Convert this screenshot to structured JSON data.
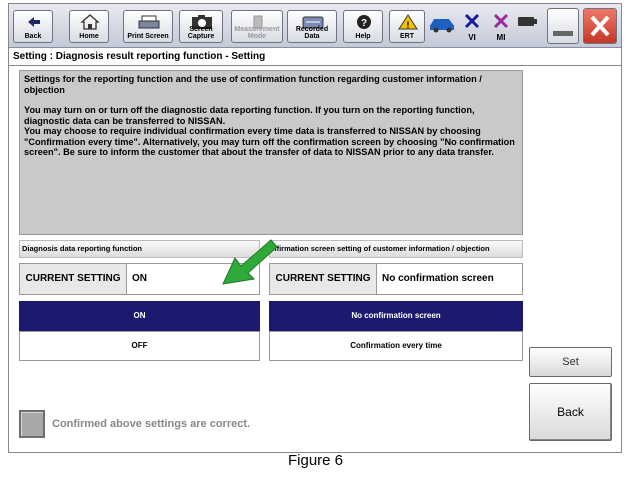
{
  "toolbar": {
    "buttons": [
      {
        "label": "Back"
      },
      {
        "label": "Home"
      },
      {
        "label": "Print Screen"
      },
      {
        "label": "Screen\nCapture"
      },
      {
        "label": "Measurement\nMode"
      },
      {
        "label": "Recorded\nData"
      },
      {
        "label": "Help"
      },
      {
        "label": "ERT"
      }
    ],
    "vi_label": "VI",
    "mi_label": "MI"
  },
  "title": "Setting : Diagnosis result reporting function - Setting",
  "message": {
    "heading": "Settings for the reporting function and the use of confirmation function regarding customer information / objection",
    "body": "You may turn on or turn off the diagnostic data reporting function. If you turn on the reporting function, diagnostic data can be transferred to NISSAN.\nYou may choose to require individual confirmation every time data is transferred to NISSAN by choosing \"Confirmation every time\". Alternatively, you may turn off the confirmation screen by choosing \"No confirmation screen\". Be sure to inform the customer that about the transfer of data to NISSAN prior to any data transfer."
  },
  "left_panel": {
    "header": "Diagnosis data reporting function",
    "current_label": "CURRENT SETTING",
    "current_value": "ON",
    "option_on": "ON",
    "option_off": "OFF"
  },
  "right_panel": {
    "header": "nfirmation screen setting of customer information / objection",
    "current_label": "CURRENT SETTING",
    "current_value": "No confirmation screen",
    "option_no_confirm": "No confirmation screen",
    "option_every_time": "Confirmation every time"
  },
  "set_label": "Set",
  "back_label": "Back",
  "confirm_label": "Confirmed above settings are correct.",
  "caption": "Figure 6",
  "colors": {
    "selected_option": "#1c1a6e",
    "arrow": "#2faa3a",
    "close_button": "#d9473a"
  }
}
